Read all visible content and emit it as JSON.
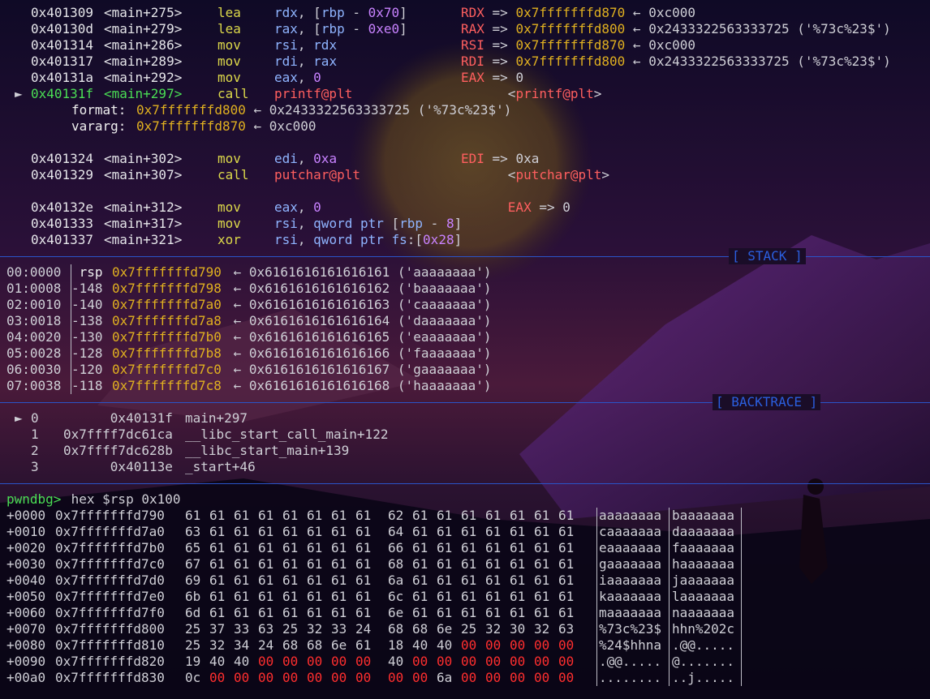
{
  "disasm": [
    {
      "marker": "",
      "addr": "0x401309",
      "sym": "<main+275>",
      "mn": "lea",
      "ops": [
        {
          "t": "rdx",
          "c": "c-reg"
        },
        {
          "t": ", [",
          "c": "c-dim"
        },
        {
          "t": "rbp",
          "c": "c-reg"
        },
        {
          "t": " - ",
          "c": "c-dim"
        },
        {
          "t": "0x70",
          "c": "c-num"
        },
        {
          "t": "]",
          "c": "c-dim"
        }
      ],
      "cm": [
        {
          "t": "RDX",
          "c": "c-red"
        },
        {
          "t": " => ",
          "c": "c-dim"
        },
        {
          "t": "0x7fffffffd870",
          "c": "c-stk"
        },
        {
          "t": " ← 0xc000",
          "c": "c-dim"
        }
      ]
    },
    {
      "marker": "",
      "addr": "0x40130d",
      "sym": "<main+279>",
      "mn": "lea",
      "ops": [
        {
          "t": "rax",
          "c": "c-reg"
        },
        {
          "t": ", [",
          "c": "c-dim"
        },
        {
          "t": "rbp",
          "c": "c-reg"
        },
        {
          "t": " - ",
          "c": "c-dim"
        },
        {
          "t": "0xe0",
          "c": "c-num"
        },
        {
          "t": "]",
          "c": "c-dim"
        }
      ],
      "cm": [
        {
          "t": "RAX",
          "c": "c-red"
        },
        {
          "t": " => ",
          "c": "c-dim"
        },
        {
          "t": "0x7fffffffd800",
          "c": "c-stk"
        },
        {
          "t": " ← 0x2433322563333725 ('%73c%23$')",
          "c": "c-dim"
        }
      ]
    },
    {
      "marker": "",
      "addr": "0x401314",
      "sym": "<main+286>",
      "mn": "mov",
      "ops": [
        {
          "t": "rsi",
          "c": "c-reg"
        },
        {
          "t": ", ",
          "c": "c-dim"
        },
        {
          "t": "rdx",
          "c": "c-reg"
        }
      ],
      "cm": [
        {
          "t": "RSI",
          "c": "c-red"
        },
        {
          "t": " => ",
          "c": "c-dim"
        },
        {
          "t": "0x7fffffffd870",
          "c": "c-stk"
        },
        {
          "t": " ← 0xc000",
          "c": "c-dim"
        }
      ]
    },
    {
      "marker": "",
      "addr": "0x401317",
      "sym": "<main+289>",
      "mn": "mov",
      "ops": [
        {
          "t": "rdi",
          "c": "c-reg"
        },
        {
          "t": ", ",
          "c": "c-dim"
        },
        {
          "t": "rax",
          "c": "c-reg"
        }
      ],
      "cm": [
        {
          "t": "RDI",
          "c": "c-red"
        },
        {
          "t": " => ",
          "c": "c-dim"
        },
        {
          "t": "0x7fffffffd800",
          "c": "c-stk"
        },
        {
          "t": " ← 0x2433322563333725 ('%73c%23$')",
          "c": "c-dim"
        }
      ]
    },
    {
      "marker": "",
      "addr": "0x40131a",
      "sym": "<main+292>",
      "mn": "mov",
      "ops": [
        {
          "t": "eax",
          "c": "c-reg"
        },
        {
          "t": ", ",
          "c": "c-dim"
        },
        {
          "t": "0",
          "c": "c-num"
        }
      ],
      "cm": [
        {
          "t": "EAX",
          "c": "c-red"
        },
        {
          "t": " => 0",
          "c": "c-dim"
        }
      ]
    },
    {
      "marker": "►",
      "addr": "0x40131f",
      "sym": "<main+297>",
      "mn": "call",
      "cur": true,
      "ops": [
        {
          "t": "printf@plt",
          "c": "c-red"
        }
      ],
      "cm": [
        {
          "t": "      <",
          "c": "c-dim"
        },
        {
          "t": "printf@plt",
          "c": "c-red"
        },
        {
          "t": ">",
          "c": "c-dim"
        }
      ]
    }
  ],
  "args": [
    {
      "label": "format:",
      "addr": "0x7fffffffd800",
      "rest": " ← 0x2433322563333725 ('%73c%23$')"
    },
    {
      "label": "vararg:",
      "addr": "0x7fffffffd870",
      "rest": " ← 0xc000"
    }
  ],
  "disasm2": [
    {
      "addr": "0x401324",
      "sym": "<main+302>",
      "mn": "mov",
      "ops": [
        {
          "t": "edi",
          "c": "c-reg"
        },
        {
          "t": ", ",
          "c": "c-dim"
        },
        {
          "t": "0xa",
          "c": "c-num"
        }
      ],
      "cm": [
        {
          "t": "EDI",
          "c": "c-red"
        },
        {
          "t": " => 0xa",
          "c": "c-dim"
        }
      ]
    },
    {
      "addr": "0x401329",
      "sym": "<main+307>",
      "mn": "call",
      "ops": [
        {
          "t": "putchar@plt",
          "c": "c-red"
        }
      ],
      "cm": [
        {
          "t": "      <",
          "c": "c-dim"
        },
        {
          "t": "putchar@plt",
          "c": "c-red"
        },
        {
          "t": ">",
          "c": "c-dim"
        }
      ]
    }
  ],
  "disasm3": [
    {
      "addr": "0x40132e",
      "sym": "<main+312>",
      "mn": "mov",
      "ops": [
        {
          "t": "eax",
          "c": "c-reg"
        },
        {
          "t": ", ",
          "c": "c-dim"
        },
        {
          "t": "0",
          "c": "c-num"
        }
      ],
      "cm": [
        {
          "t": "      EAX",
          "c": "c-red"
        },
        {
          "t": " => 0",
          "c": "c-dim"
        }
      ]
    },
    {
      "addr": "0x401333",
      "sym": "<main+317>",
      "mn": "mov",
      "ops": [
        {
          "t": "rsi",
          "c": "c-reg"
        },
        {
          "t": ", ",
          "c": "c-dim"
        },
        {
          "t": "qword ptr",
          "c": "c-reg"
        },
        {
          "t": " [",
          "c": "c-dim"
        },
        {
          "t": "rbp",
          "c": "c-reg"
        },
        {
          "t": " - ",
          "c": "c-dim"
        },
        {
          "t": "8",
          "c": "c-num"
        },
        {
          "t": "]",
          "c": "c-dim"
        }
      ],
      "cm": []
    },
    {
      "addr": "0x401337",
      "sym": "<main+321>",
      "mn": "xor",
      "ops": [
        {
          "t": "rsi",
          "c": "c-reg"
        },
        {
          "t": ", ",
          "c": "c-dim"
        },
        {
          "t": "qword ptr",
          "c": "c-reg"
        },
        {
          "t": " ",
          "c": "c-dim"
        },
        {
          "t": "fs",
          "c": "c-reg"
        },
        {
          "t": ":[",
          "c": "c-dim"
        },
        {
          "t": "0x28",
          "c": "c-num"
        },
        {
          "t": "]",
          "c": "c-dim"
        }
      ],
      "cm": []
    }
  ],
  "stack_title": "[ STACK ]",
  "stack": [
    {
      "idx": "00:0000",
      "off": " rsp",
      "addr": "0x7fffffffd790",
      "val": " ← 0x6161616161616161 ('aaaaaaaa')"
    },
    {
      "idx": "01:0008",
      "off": "-148",
      "addr": "0x7fffffffd798",
      "val": " ← 0x6161616161616162 ('baaaaaaa')"
    },
    {
      "idx": "02:0010",
      "off": "-140",
      "addr": "0x7fffffffd7a0",
      "val": " ← 0x6161616161616163 ('caaaaaaa')"
    },
    {
      "idx": "03:0018",
      "off": "-138",
      "addr": "0x7fffffffd7a8",
      "val": " ← 0x6161616161616164 ('daaaaaaa')"
    },
    {
      "idx": "04:0020",
      "off": "-130",
      "addr": "0x7fffffffd7b0",
      "val": " ← 0x6161616161616165 ('eaaaaaaa')"
    },
    {
      "idx": "05:0028",
      "off": "-128",
      "addr": "0x7fffffffd7b8",
      "val": " ← 0x6161616161616166 ('faaaaaaa')"
    },
    {
      "idx": "06:0030",
      "off": "-120",
      "addr": "0x7fffffffd7c0",
      "val": " ← 0x6161616161616167 ('gaaaaaaa')"
    },
    {
      "idx": "07:0038",
      "off": "-118",
      "addr": "0x7fffffffd7c8",
      "val": " ← 0x6161616161616168 ('haaaaaaa')"
    }
  ],
  "backtrace_title": "[ BACKTRACE ]",
  "backtrace": [
    {
      "marker": "►",
      "n": "0",
      "addr": "      0x40131f",
      "fn": "main+297"
    },
    {
      "marker": "",
      "n": "1",
      "addr": "0x7ffff7dc61ca",
      "fn": "__libc_start_call_main+122"
    },
    {
      "marker": "",
      "n": "2",
      "addr": "0x7ffff7dc628b",
      "fn": "__libc_start_main+139"
    },
    {
      "marker": "",
      "n": "3",
      "addr": "      0x40113e",
      "fn": "_start+46"
    }
  ],
  "prompt": {
    "name": "pwndbg>",
    "cmd": " hex $rsp 0x100"
  },
  "hexdump": [
    {
      "off": "+0000",
      "addr": "0x7fffffffd790",
      "b1": [
        "61",
        "61",
        "61",
        "61",
        "61",
        "61",
        "61",
        "61"
      ],
      "b2": [
        "62",
        "61",
        "61",
        "61",
        "61",
        "61",
        "61",
        "61"
      ],
      "a1": "aaaaaaaa",
      "a2": "baaaaaaa"
    },
    {
      "off": "+0010",
      "addr": "0x7fffffffd7a0",
      "b1": [
        "63",
        "61",
        "61",
        "61",
        "61",
        "61",
        "61",
        "61"
      ],
      "b2": [
        "64",
        "61",
        "61",
        "61",
        "61",
        "61",
        "61",
        "61"
      ],
      "a1": "caaaaaaa",
      "a2": "daaaaaaa"
    },
    {
      "off": "+0020",
      "addr": "0x7fffffffd7b0",
      "b1": [
        "65",
        "61",
        "61",
        "61",
        "61",
        "61",
        "61",
        "61"
      ],
      "b2": [
        "66",
        "61",
        "61",
        "61",
        "61",
        "61",
        "61",
        "61"
      ],
      "a1": "eaaaaaaa",
      "a2": "faaaaaaa"
    },
    {
      "off": "+0030",
      "addr": "0x7fffffffd7c0",
      "b1": [
        "67",
        "61",
        "61",
        "61",
        "61",
        "61",
        "61",
        "61"
      ],
      "b2": [
        "68",
        "61",
        "61",
        "61",
        "61",
        "61",
        "61",
        "61"
      ],
      "a1": "gaaaaaaa",
      "a2": "haaaaaaa"
    },
    {
      "off": "+0040",
      "addr": "0x7fffffffd7d0",
      "b1": [
        "69",
        "61",
        "61",
        "61",
        "61",
        "61",
        "61",
        "61"
      ],
      "b2": [
        "6a",
        "61",
        "61",
        "61",
        "61",
        "61",
        "61",
        "61"
      ],
      "a1": "iaaaaaaa",
      "a2": "jaaaaaaa"
    },
    {
      "off": "+0050",
      "addr": "0x7fffffffd7e0",
      "b1": [
        "6b",
        "61",
        "61",
        "61",
        "61",
        "61",
        "61",
        "61"
      ],
      "b2": [
        "6c",
        "61",
        "61",
        "61",
        "61",
        "61",
        "61",
        "61"
      ],
      "a1": "kaaaaaaa",
      "a2": "laaaaaaa"
    },
    {
      "off": "+0060",
      "addr": "0x7fffffffd7f0",
      "b1": [
        "6d",
        "61",
        "61",
        "61",
        "61",
        "61",
        "61",
        "61"
      ],
      "b2": [
        "6e",
        "61",
        "61",
        "61",
        "61",
        "61",
        "61",
        "61"
      ],
      "a1": "maaaaaaa",
      "a2": "naaaaaaa"
    },
    {
      "off": "+0070",
      "addr": "0x7fffffffd800",
      "b1": [
        "25",
        "37",
        "33",
        "63",
        "25",
        "32",
        "33",
        "24"
      ],
      "b2": [
        "68",
        "68",
        "6e",
        "25",
        "32",
        "30",
        "32",
        "63"
      ],
      "a1": "%73c%23$",
      "a2": "hhn%202c"
    },
    {
      "off": "+0080",
      "addr": "0x7fffffffd810",
      "b1": [
        "25",
        "32",
        "34",
        "24",
        "68",
        "68",
        "6e",
        "61"
      ],
      "b2": [
        "18",
        "40",
        "40",
        "00",
        "00",
        "00",
        "00",
        "00"
      ],
      "a1": "%24$hhna",
      "a2": ".@@....."
    },
    {
      "off": "+0090",
      "addr": "0x7fffffffd820",
      "b1": [
        "19",
        "40",
        "40",
        "00",
        "00",
        "00",
        "00",
        "00"
      ],
      "b2": [
        "40",
        "00",
        "00",
        "00",
        "00",
        "00",
        "00",
        "00"
      ],
      "a1": ".@@.....",
      "a2": "@......."
    },
    {
      "off": "+00a0",
      "addr": "0x7fffffffd830",
      "b1": [
        "0c",
        "00",
        "00",
        "00",
        "00",
        "00",
        "00",
        "00"
      ],
      "b2": [
        "00",
        "00",
        "6a",
        "00",
        "00",
        "00",
        "00",
        "00"
      ],
      "a1": "........",
      "a2": "..j....."
    }
  ],
  "colors": {
    "accent": "#2b5fe0",
    "addr": "#e0b020",
    "mnemonic": "#dcd84a",
    "register": "#8fb4ff",
    "current": "#4ade54",
    "highlight": "#ff5f5f"
  }
}
